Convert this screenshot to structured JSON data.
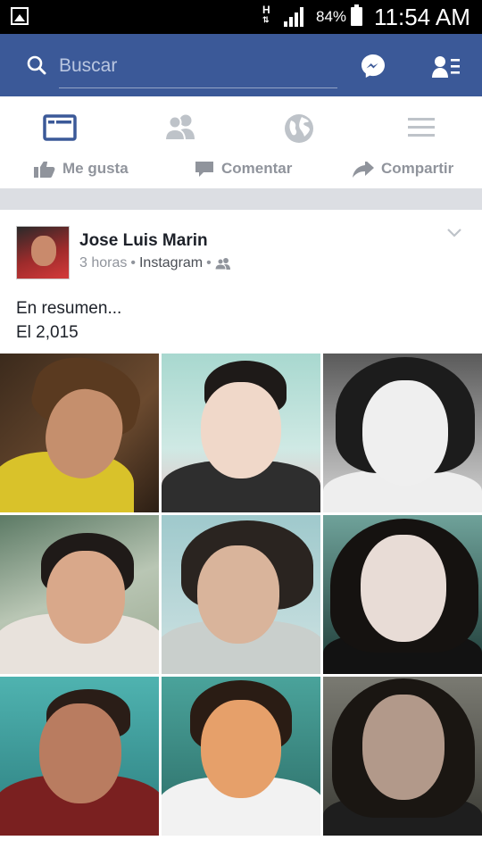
{
  "status_bar": {
    "network": "H",
    "battery": "84%",
    "time": "11:54 AM"
  },
  "search": {
    "placeholder": "Buscar"
  },
  "tabs": [
    {
      "name": "news-feed-icon",
      "active": true
    },
    {
      "name": "friend-requests-icon",
      "active": false
    },
    {
      "name": "notifications-globe-icon",
      "active": false
    },
    {
      "name": "menu-icon",
      "active": false
    }
  ],
  "previous_post_actions": {
    "like": "Me gusta",
    "comment": "Comentar",
    "share": "Compartir"
  },
  "post": {
    "author": "Jose Luis Marin",
    "time": "3 horas",
    "separator": "•",
    "source": "Instagram",
    "text_line1": "En resumen...",
    "text_line2": "El 2,015"
  },
  "colors": {
    "brand_blue": "#3b5998",
    "active_tab": "#3b5998",
    "inactive_tab": "#bec3c9"
  }
}
